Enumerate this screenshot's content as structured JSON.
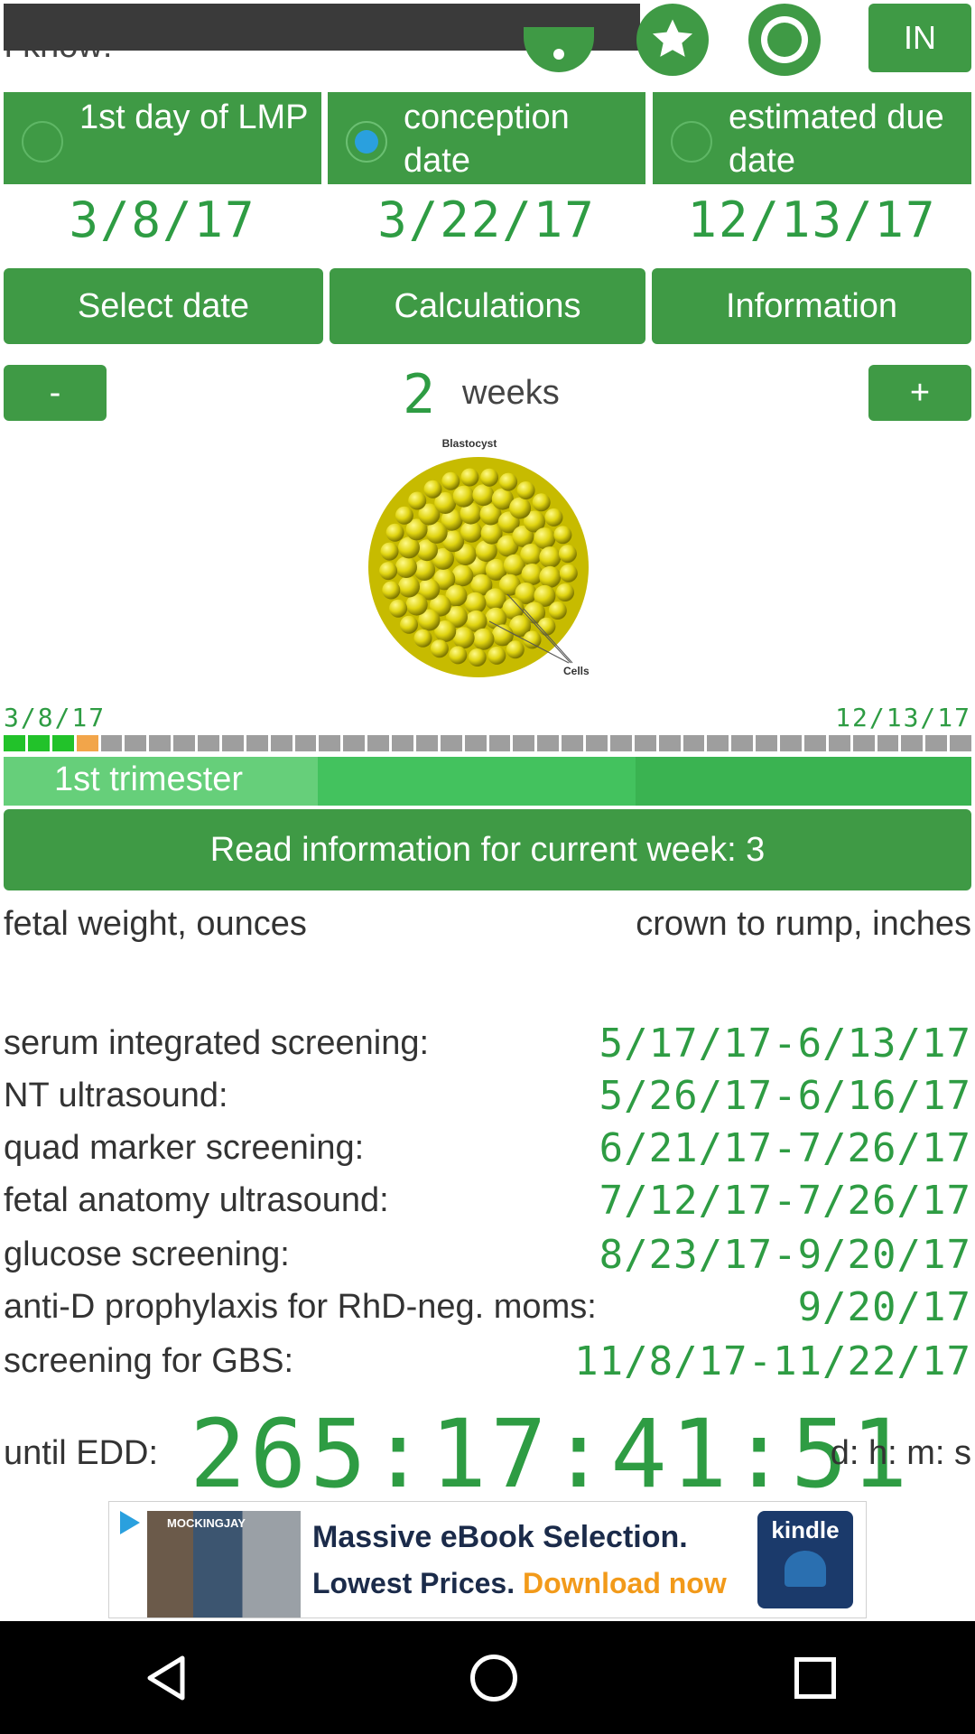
{
  "top_label": "I know:",
  "top_bar": {
    "lang_label": "IN"
  },
  "modes": [
    {
      "label": "1st day of LMP",
      "date": "3/8/17",
      "selected": false
    },
    {
      "label": "conception date",
      "date": "3/22/17",
      "selected": true
    },
    {
      "label": "estimated due date",
      "date": "12/13/17",
      "selected": false
    }
  ],
  "actions": {
    "select": "Select date",
    "calc": "Calculations",
    "info": "Information"
  },
  "weeks": {
    "minus": "-",
    "plus": "+",
    "value": "2",
    "unit": "weeks"
  },
  "illustration": {
    "title": "Blastocyst",
    "callout": "Cells"
  },
  "timeline": {
    "start": "3/8/17",
    "end": "12/13/17",
    "weeks_total": 40,
    "weeks_green": 3,
    "weeks_orange": 1
  },
  "trimester_label": "1st trimester",
  "read_button": "Read information for current week: 3",
  "metrics": {
    "left": "fetal weight, ounces",
    "right": "crown to rump, inches"
  },
  "screenings": [
    {
      "label": "serum integrated screening:",
      "value": "5/17/17-6/13/17"
    },
    {
      "label": "NT ultrasound:",
      "value": "5/26/17-6/16/17"
    },
    {
      "label": "quad marker screening:",
      "value": "6/21/17-7/26/17"
    },
    {
      "label": "fetal anatomy ultrasound:",
      "value": "7/12/17-7/26/17"
    },
    {
      "label": "glucose screening:",
      "value": "8/23/17-9/20/17"
    },
    {
      "label": "anti-D prophylaxis for RhD-neg. moms:",
      "value": "9/20/17"
    },
    {
      "label": "screening for GBS:",
      "value": "11/8/17-11/22/17"
    }
  ],
  "countdown": {
    "label": "until EDD:",
    "value": "265:17:41:51",
    "units": "d: h: m: s"
  },
  "ad": {
    "line1": "Massive eBook Selection.",
    "line2a": "Lowest Prices. ",
    "line2b": "Download now",
    "brand": "kindle",
    "book": "MOCKINGJAY"
  },
  "colors": {
    "primary": "#3f9a45",
    "digits": "#2e9c43",
    "light_green": "#3fc45f",
    "orange": "#f2a54a",
    "ad_accent": "#f29a1a"
  }
}
